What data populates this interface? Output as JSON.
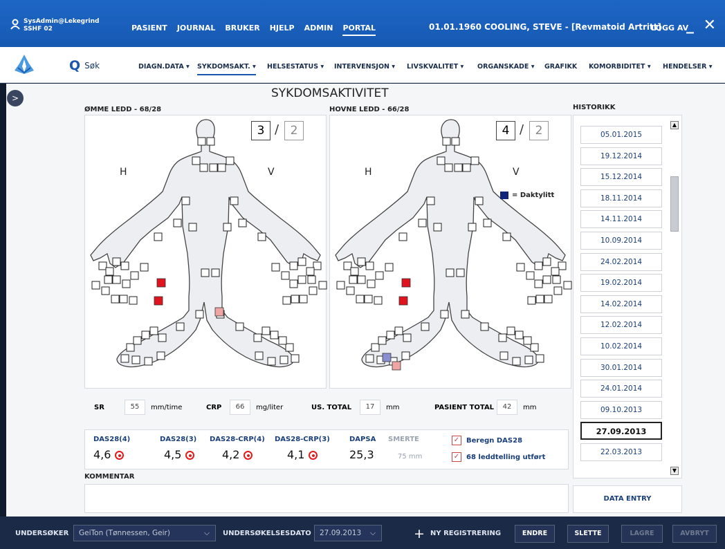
{
  "header": {
    "user_line1": "SysAdmin@Lekegrind",
    "user_line2": "SSHF 02",
    "nav": [
      "PASIENT",
      "JOURNAL",
      "BRUKER",
      "HJELP",
      "ADMIN",
      "PORTAL"
    ],
    "patient": "01.01.1960 COOLING, STEVE - [Revmatoid Artritt]",
    "logout": "LOGG AV",
    "minimize": "_",
    "close": "✕"
  },
  "subnav": {
    "search_label": "Søk",
    "tabs": [
      "DIAGN.DATA",
      "SYKDOMSAKT.",
      "HELSESTATUS",
      "INTERVENSJON",
      "LIVSKVALITET",
      "ORGANSKADE",
      "GRAFIKK",
      "KOMORBIDITET",
      "HENDELSER"
    ],
    "active_tab": "SYKDOMSAKT."
  },
  "page": {
    "title": "SYKDOMSAKTIVITET",
    "expander": ">",
    "tender_label": "ØMME LEDD - 68/28",
    "swollen_label": "HOVNE LEDD - 66/28",
    "history_label": "HISTORIKK",
    "comment_label": "KOMMENTAR"
  },
  "tender": {
    "count_a": "3",
    "count_b": "2",
    "slash": "/",
    "right_label": "H",
    "left_label": "V"
  },
  "swollen": {
    "count_a": "4",
    "count_b": "2",
    "slash": "/",
    "right_label": "H",
    "left_label": "V",
    "legend": "= Daktylitt"
  },
  "colors": {
    "active_joint": "#e0141e",
    "light_joint": "#f0a5a5",
    "dactylitis": "#8a8fd2"
  },
  "history": [
    "05.01.2015",
    "19.12.2014",
    "15.12.2014",
    "18.11.2014",
    "14.11.2014",
    "10.09.2014",
    "24.02.2014",
    "19.02.2014",
    "14.02.2014",
    "12.02.2014",
    "10.02.2014",
    "30.01.2014",
    "24.01.2014",
    "09.10.2013",
    "27.09.2013",
    "22.03.2013"
  ],
  "history_selected": "27.09.2013",
  "labs": {
    "sr_label": "SR",
    "sr_value": "55",
    "sr_unit": "mm/time",
    "crp_label": "CRP",
    "crp_value": "66",
    "crp_unit": "mg/liter",
    "us_label": "US. TOTAL",
    "us_value": "17",
    "us_unit": "mm",
    "pt_label": "PASIENT TOTAL",
    "pt_value": "42",
    "pt_unit": "mm"
  },
  "scores": [
    {
      "label": "DAS28(4)",
      "value": "4,6"
    },
    {
      "label": "DAS28(3)",
      "value": "4,5"
    },
    {
      "label": "DAS28-CRP(4)",
      "value": "4,2"
    },
    {
      "label": "DAS28-CRP(3)",
      "value": "4,1"
    },
    {
      "label": "DAPSA",
      "value": "25,3"
    },
    {
      "label": "SMERTE",
      "value": "75 mm"
    }
  ],
  "checks": [
    {
      "label": "Beregn DAS28",
      "checked": true
    },
    {
      "label": "68 leddtelling utført",
      "checked": true
    }
  ],
  "data_entry": "DATA ENTRY",
  "footer": {
    "examiner_label": "UNDERSØKER",
    "examiner_value": "GeiTon (Tønnessen, Geir)",
    "date_label": "UNDERSØKELSESDATO",
    "date_value": "27.09.2013",
    "new_reg": "NY REGISTRERING",
    "buttons": [
      "ENDRE",
      "SLETTE",
      "LAGRE",
      "AVBRYT"
    ]
  }
}
